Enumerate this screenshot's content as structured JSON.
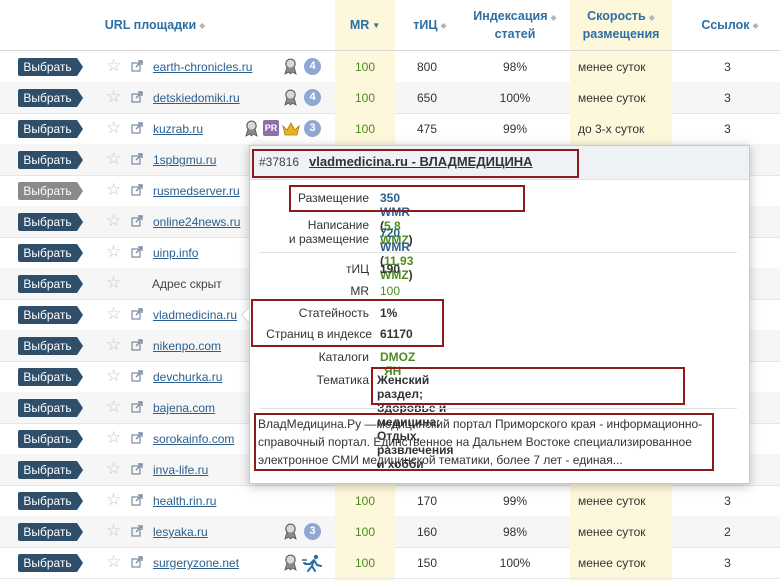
{
  "headers": {
    "url": "URL площадки",
    "mr": "MR",
    "tic": "тИЦ",
    "idx_line1": "Индексация",
    "idx_line2": "статей",
    "spd_line1": "Скорость",
    "spd_line2": "размещения",
    "links": "Ссылок"
  },
  "colors": {
    "accent": "#2e6fa3",
    "button": "#2f4e6a",
    "mr_col": "#fdf8dc",
    "spd_col": "#fdf8dc",
    "red_box": "#8e1a1a",
    "green": "#4c8c1e"
  },
  "rows": [
    {
      "btn": "Выбрать",
      "url": "earth-chronicles.ru",
      "mr": "100",
      "tic": "800",
      "idx": "98%",
      "spd": "менее суток",
      "links": "3",
      "badge": "4"
    },
    {
      "btn": "Выбрать",
      "url": "detskiedomiki.ru",
      "mr": "100",
      "tic": "650",
      "idx": "100%",
      "spd": "менее суток",
      "links": "3",
      "badge": "4"
    },
    {
      "btn": "Выбрать",
      "url": "kuzrab.ru",
      "mr": "100",
      "tic": "475",
      "idx": "99%",
      "spd": "до 3-х суток",
      "links": "3",
      "badge": "3",
      "pr": "PR"
    },
    {
      "btn": "Выбрать",
      "url": "1spbgmu.ru",
      "mr": "",
      "tic": "",
      "idx": "",
      "spd": "",
      "links": ""
    },
    {
      "btn": "Выбрать",
      "url": "rusmedserver.ru",
      "mr": "",
      "tic": "",
      "idx": "",
      "spd": "",
      "links": ""
    },
    {
      "btn": "Выбрать",
      "url": "online24news.ru",
      "mr": "",
      "tic": "",
      "idx": "",
      "spd": "",
      "links": ""
    },
    {
      "btn": "Выбрать",
      "url": "uinp.info",
      "mr": "",
      "tic": "",
      "idx": "",
      "spd": "",
      "links": ""
    },
    {
      "btn": "Выбрать",
      "url": "Адрес скрыт",
      "mr": "",
      "tic": "",
      "idx": "",
      "spd": "",
      "links": ""
    },
    {
      "btn": "Выбрать",
      "url": "vladmedicina.ru",
      "mr": "",
      "tic": "",
      "idx": "",
      "spd": "",
      "links": ""
    },
    {
      "btn": "Выбрать",
      "url": "nikenpo.com",
      "mr": "",
      "tic": "",
      "idx": "",
      "spd": "",
      "links": ""
    },
    {
      "btn": "Выбрать",
      "url": "devchurka.ru",
      "mr": "",
      "tic": "",
      "idx": "",
      "spd": "",
      "links": ""
    },
    {
      "btn": "Выбрать",
      "url": "bajena.com",
      "mr": "",
      "tic": "",
      "idx": "",
      "spd": "",
      "links": ""
    },
    {
      "btn": "Выбрать",
      "url": "sorokainfo.com",
      "mr": "",
      "tic": "",
      "idx": "",
      "spd": "",
      "links": ""
    },
    {
      "btn": "Выбрать",
      "url": "inva-life.ru",
      "mr": "",
      "tic": "",
      "idx": "",
      "spd": "",
      "links": ""
    },
    {
      "btn": "Выбрать",
      "url": "health.rin.ru",
      "mr": "100",
      "tic": "170",
      "idx": "99%",
      "spd": "менее суток",
      "links": "3"
    },
    {
      "btn": "Выбрать",
      "url": "lesyaka.ru",
      "mr": "100",
      "tic": "160",
      "idx": "98%",
      "spd": "менее суток",
      "links": "2",
      "badge": "3"
    },
    {
      "btn": "Выбрать",
      "url": "surgeryzone.net",
      "mr": "100",
      "tic": "150",
      "idx": "100%",
      "spd": "менее суток",
      "links": "3"
    }
  ],
  "popup": {
    "id": "#37816",
    "title": "vladmedicina.ru - ВЛАДМЕДИЦИНА",
    "placement_label": "Размещение",
    "placement_wmr": "350 WMR",
    "placement_wmz": "5.8 WMZ",
    "writing_label_1": "Написание",
    "writing_label_2": "и размещение",
    "writing_wmr": "720 WMR",
    "writing_wmz": "11.93 WMZ",
    "tic_label": "тИЦ",
    "tic_value": "190",
    "mr_label": "MR",
    "mr_value": "100",
    "articles_label": "Статейность",
    "articles_value": "1%",
    "pages_label": "Страниц в индексе",
    "pages_value": "61170",
    "catalogs_label": "Каталоги",
    "catalog_1": "DMOZ",
    "catalog_2": "ЯН",
    "topic_label": "Тематика",
    "topic_value_1": "Женский раздел; Здоровье и медицина; Отдых,",
    "topic_value_2": "развлечения и хобби",
    "desc_1": "ВладМедицина.Ру —медицинский портал Приморского края - информационно-",
    "desc_2": "справочный портал. Единственное на Дальнем Востоке специализированное",
    "desc_3": "электронное СМИ медицинской тематики, более 7 лет - единая..."
  }
}
